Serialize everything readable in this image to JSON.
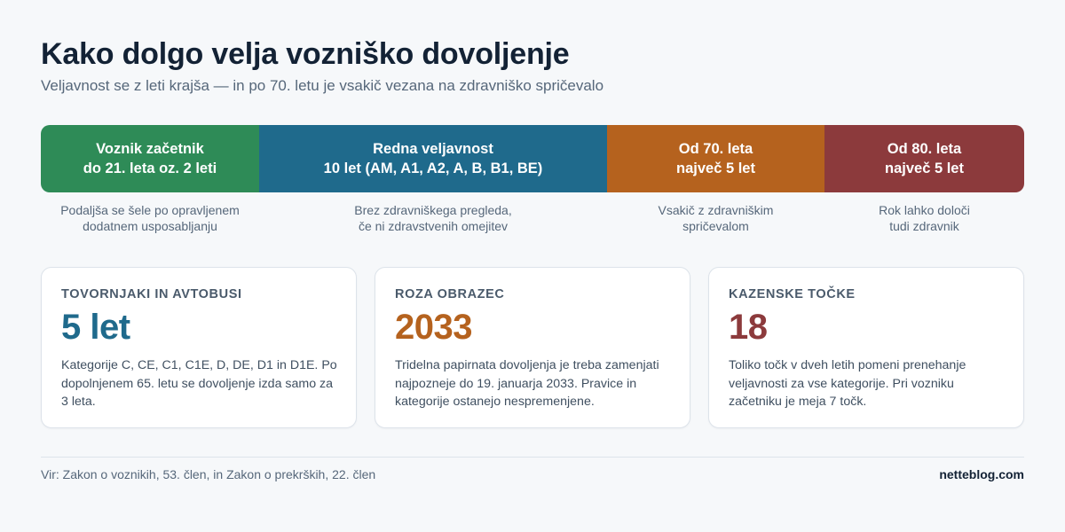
{
  "header": {
    "title": "Kako dolgo velja vozniško dovoljenje",
    "subtitle": "Veljavnost se z leti krajša — in po 70. letu je vsakič vezana na zdravniško spričevalo"
  },
  "timeline": {
    "segments": [
      {
        "lines": [
          "Voznik začetnik",
          "do 21. leta oz. 2 leti"
        ],
        "caption": [
          "Podaljša se šele po opravljenem",
          "dodatnem usposabljanju"
        ],
        "color": "#2e8b57"
      },
      {
        "lines": [
          "Redna veljavnost",
          "10 let (AM, A1, A2, A, B, B1, BE)"
        ],
        "caption": [
          "Brez zdravniškega pregleda,",
          "če ni zdravstvenih omejitev"
        ],
        "color": "#1f6a8c"
      },
      {
        "lines": [
          "Od 70. leta",
          "največ 5 let"
        ],
        "caption": [
          "Vsakič z zdravniškim",
          "spričevalom"
        ],
        "color": "#b5621e"
      },
      {
        "lines": [
          "Od 80. leta",
          "največ 5 let"
        ],
        "caption": [
          "Rok lahko določi",
          "tudi zdravnik"
        ],
        "color": "#8c3a3c"
      }
    ]
  },
  "cards": [
    {
      "label": "TOVORNJAKI IN AVTOBUSI",
      "value": "5 let",
      "value_color": "#1f6a8c",
      "text": [
        "Kategorije C, CE, C1, C1E, D, DE, D1 in D1E. Po",
        "dopolnjenem 65. letu se dovoljenje izda samo za",
        "3 leta."
      ]
    },
    {
      "label": "ROZA OBRAZEC",
      "value": "2033",
      "value_color": "#b5621e",
      "text": [
        "Tridelna papirnata dovoljenja je treba zamenjati",
        "najpozneje do 19. januarja 2033. Pravice in",
        "kategorije ostanejo nespremenjene."
      ]
    },
    {
      "label": "KAZENSKE TOČKE",
      "value": "18",
      "value_color": "#8c3a3c",
      "text": [
        "Toliko točk v dveh letih pomeni prenehanje",
        "veljavnosti za vse kategorije. Pri vozniku",
        "začetniku je meja 7 točk."
      ]
    }
  ],
  "footer": {
    "source": "Vir: Zakon o voznikih, 53. člen, in Zakon o prekrških, 22. člen",
    "brand": "netteblog.com"
  }
}
